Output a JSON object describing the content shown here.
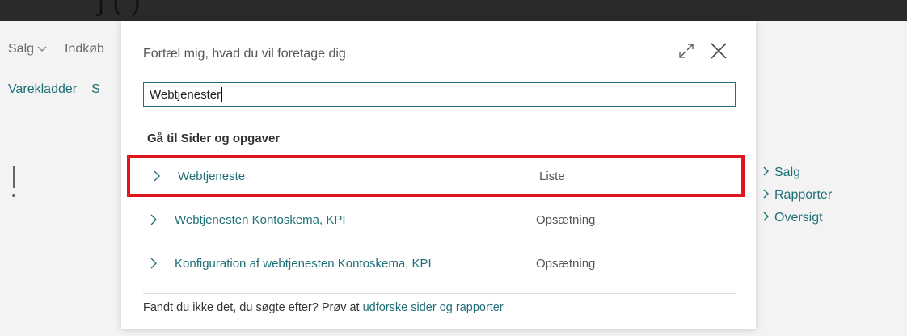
{
  "topbar": {
    "fragment": "j    (           )"
  },
  "background": {
    "nav": [
      "Salg",
      "Indkøb"
    ],
    "actions": [
      "Varekladder",
      "S"
    ],
    "side_links": [
      "Salg",
      "Rapporter",
      "Oversigt"
    ]
  },
  "modal": {
    "title": "Fortæl mig, hvad du vil foretage dig",
    "search": {
      "value": "Webtjenester"
    },
    "section_heading": "Gå til Sider og opgaver",
    "results": [
      {
        "label": "Webtjeneste",
        "type": "Liste",
        "highlighted": true
      },
      {
        "label": "Webtjenesten Kontoskema, KPI",
        "type": "Opsætning",
        "highlighted": false
      },
      {
        "label": "Konfiguration af webtjenesten Kontoskema, KPI",
        "type": "Opsætning",
        "highlighted": false
      }
    ],
    "footer": {
      "text": "Fandt du ikke det, du søgte efter? Prøv at ",
      "link": "udforske sider og rapporter"
    }
  },
  "colors": {
    "accent": "#1f6f78",
    "highlight": "#e0141e",
    "topbar": "#2a2a2a"
  },
  "icons": {
    "expand": "expand-icon",
    "close": "close-icon",
    "row": "chevron-right-icon"
  }
}
